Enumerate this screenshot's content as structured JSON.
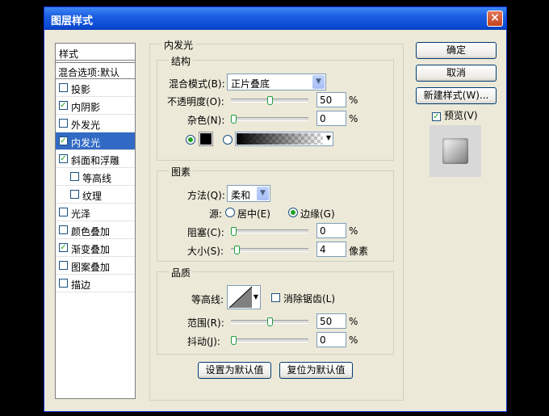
{
  "window": {
    "title": "图层样式",
    "close": "×"
  },
  "sidebar": {
    "heading": "样式",
    "blend_options": "混合选项:默认",
    "items": [
      {
        "label": "投影",
        "checked": false,
        "selected": false
      },
      {
        "label": "内阴影",
        "checked": true,
        "selected": false
      },
      {
        "label": "外发光",
        "checked": false,
        "selected": false
      },
      {
        "label": "内发光",
        "checked": true,
        "selected": true
      },
      {
        "label": "斜面和浮雕",
        "checked": true,
        "selected": false
      },
      {
        "label": "等高线",
        "checked": false,
        "selected": false,
        "indent": true
      },
      {
        "label": "纹理",
        "checked": false,
        "selected": false,
        "indent": true
      },
      {
        "label": "光泽",
        "checked": false,
        "selected": false
      },
      {
        "label": "颜色叠加",
        "checked": false,
        "selected": false
      },
      {
        "label": "渐变叠加",
        "checked": true,
        "selected": false
      },
      {
        "label": "图案叠加",
        "checked": false,
        "selected": false
      },
      {
        "label": "描边",
        "checked": false,
        "selected": false
      }
    ]
  },
  "panel": {
    "title": "内发光",
    "structure": {
      "title": "结构",
      "blend_mode_label": "混合模式(B):",
      "blend_mode_value": "正片叠底",
      "opacity_label": "不透明度(O):",
      "opacity_value": "50",
      "opacity_unit": "%",
      "opacity_level": 0.5,
      "noise_label": "杂色(N):",
      "noise_value": "0",
      "noise_unit": "%",
      "noise_level": 0,
      "color_mode": "solid",
      "color": "#000000"
    },
    "elements": {
      "title": "图素",
      "method_label": "方法(Q):",
      "method_value": "柔和",
      "source_label": "源:",
      "source_center": "居中(E)",
      "source_edge": "边缘(G)",
      "source_selected": "edge",
      "choke_label": "阻塞(C):",
      "choke_value": "0",
      "choke_unit": "%",
      "choke_level": 0,
      "size_label": "大小(S):",
      "size_value": "4",
      "size_unit": "像素"
    },
    "quality": {
      "title": "品质",
      "contour_label": "等高线:",
      "antialias_label": "消除锯齿(L)",
      "antialias_checked": false,
      "range_label": "范围(R):",
      "range_value": "50",
      "range_unit": "%",
      "range_level": 0.5,
      "jitter_label": "抖动(J):",
      "jitter_value": "0",
      "jitter_unit": "%",
      "jitter_level": 0
    },
    "set_default": "设置为默认值",
    "reset_default": "复位为默认值"
  },
  "actions": {
    "ok": "确定",
    "cancel": "取消",
    "new_style": "新建样式(W)...",
    "preview_label": "预览(V)",
    "preview_checked": true
  },
  "icons": {
    "close": "close-icon",
    "dropdown": "chevron-down-icon",
    "checkmark": "check-icon",
    "slider": "slider-thumb-icon",
    "contour": "contour-curve-icon"
  }
}
